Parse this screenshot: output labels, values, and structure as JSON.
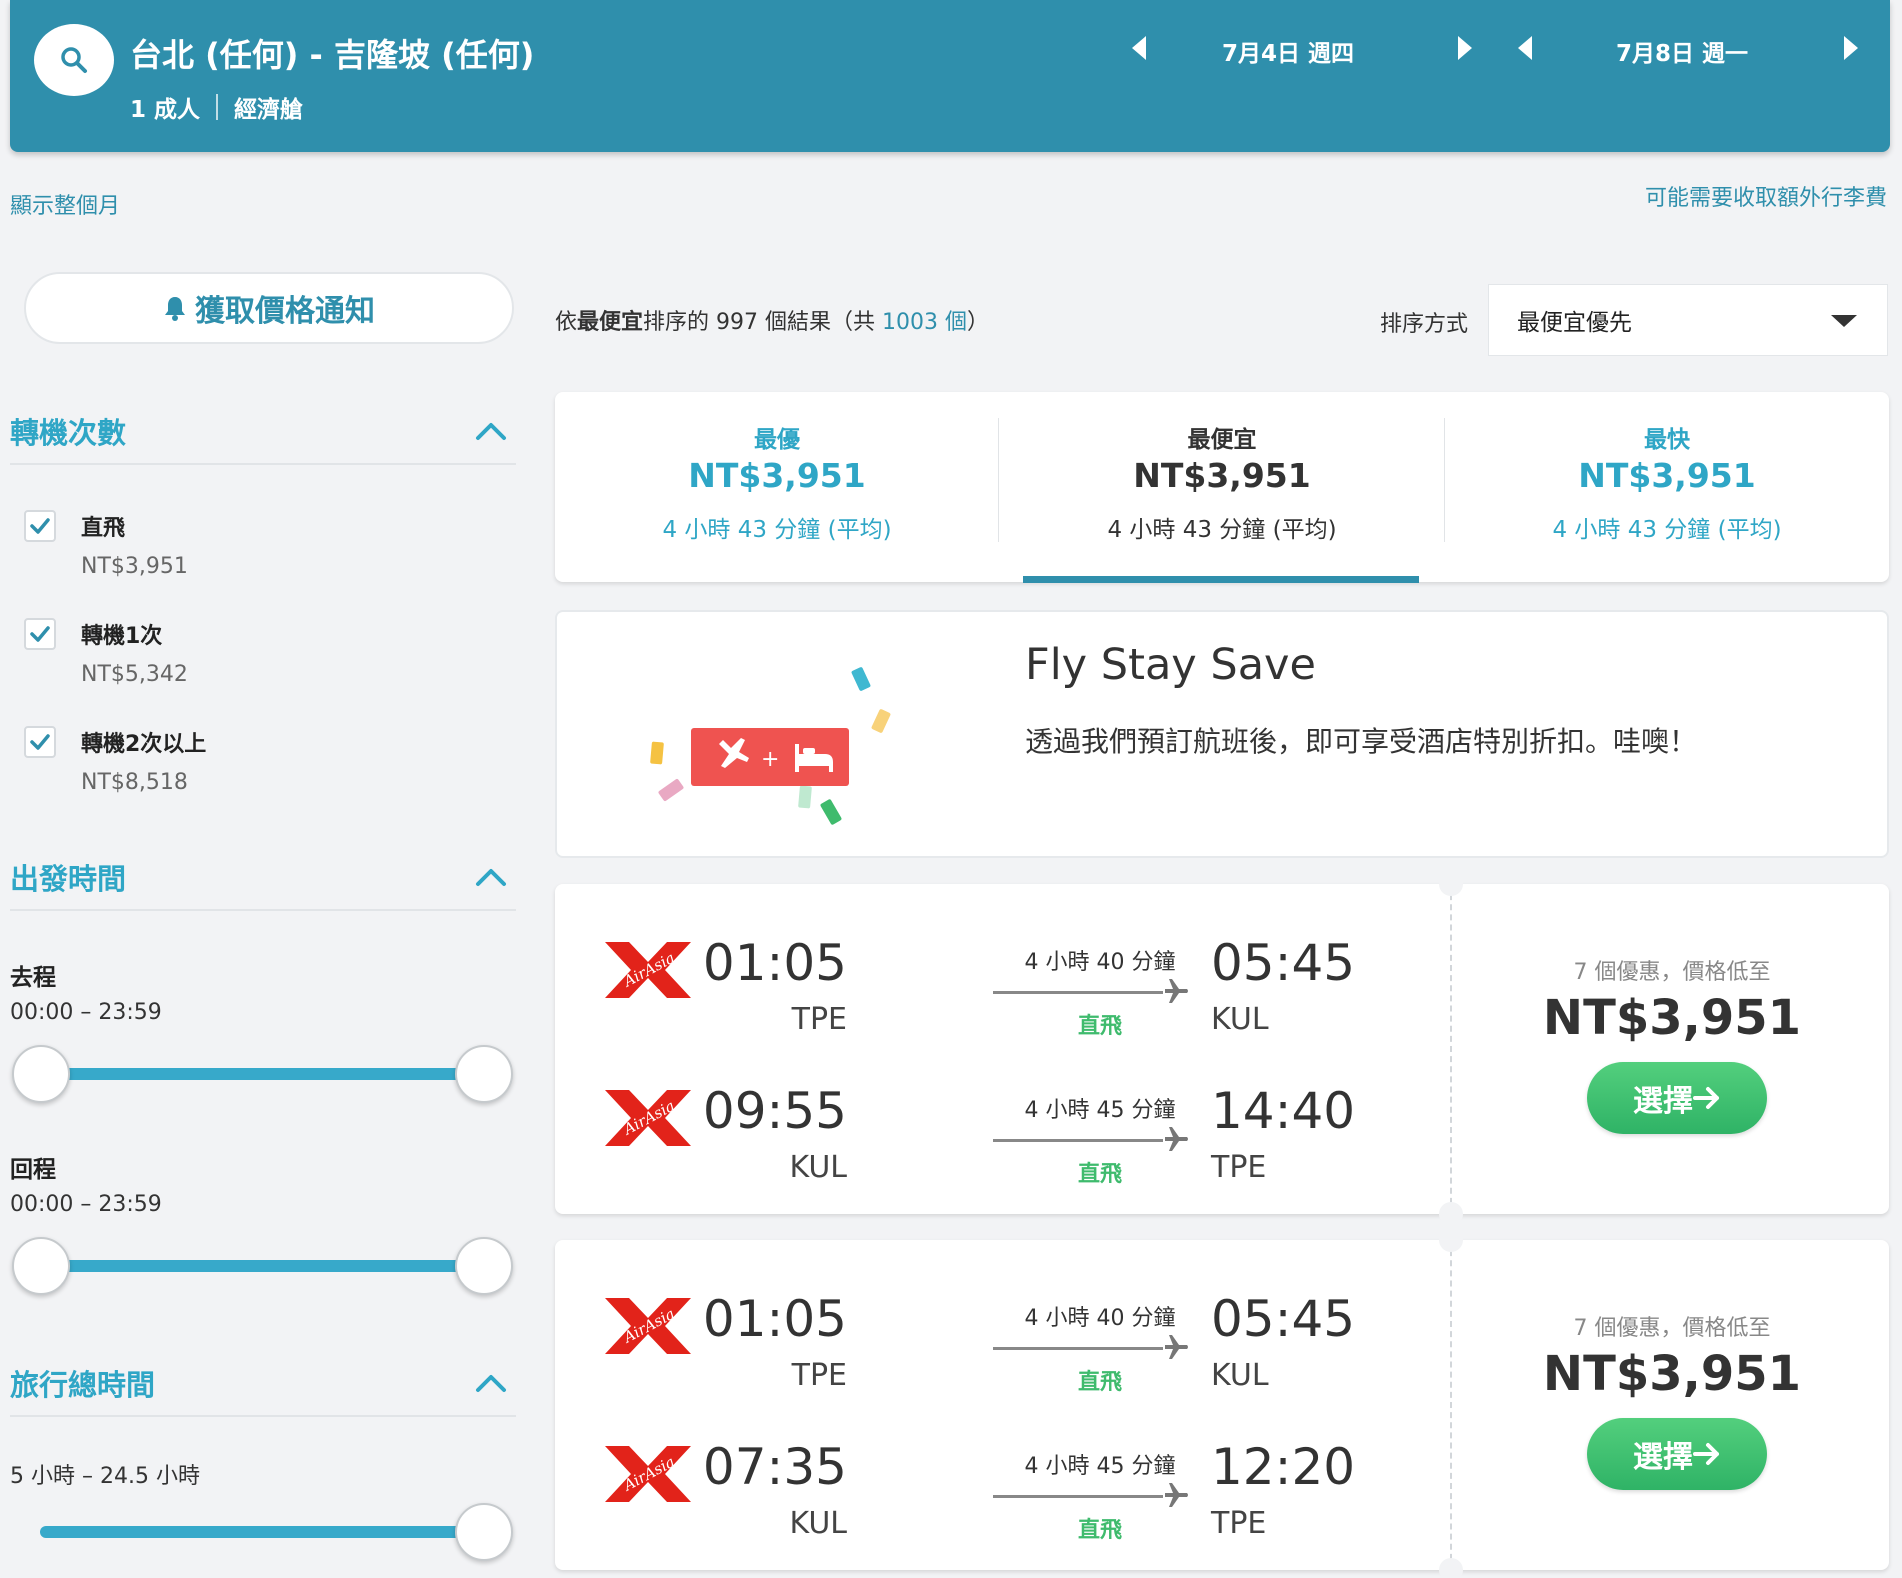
{
  "header": {
    "route": "台北 (任何) - 吉隆坡 (任何)",
    "passengers": "1 成人",
    "cabin": "經濟艙",
    "depart_date": "7月4日 週四",
    "return_date": "7月8日 週一"
  },
  "top_links": {
    "show_month": "顯示整個月",
    "baggage_notice": "可能需要收取額外行李費"
  },
  "sidebar": {
    "price_alert": "獲取價格通知",
    "stops": {
      "title": "轉機次數",
      "items": [
        {
          "label": "直飛",
          "price": "NT$3,951"
        },
        {
          "label": "轉機1次",
          "price": "NT$5,342"
        },
        {
          "label": "轉機2次以上",
          "price": "NT$8,518"
        }
      ]
    },
    "departure_time": {
      "title": "出發時間",
      "outbound_label": "去程",
      "outbound_range": "00:00 – 23:59",
      "return_label": "回程",
      "return_range": "00:00 – 23:59"
    },
    "total_duration": {
      "title": "旅行總時間",
      "range": "5 小時 – 24.5 小時"
    }
  },
  "results": {
    "summary_prefix": "依",
    "summary_sort": "最便宜",
    "summary_middle": "排序的 997 個結果（共 ",
    "summary_total": "1003 個",
    "summary_suffix": "）",
    "sort_label": "排序方式",
    "sort_value": "最便宜優先"
  },
  "sort_tabs": [
    {
      "title": "最優",
      "price": "NT$3,951",
      "duration": "4 小時 43 分鐘 (平均)"
    },
    {
      "title": "最便宜",
      "price": "NT$3,951",
      "duration": "4 小時 43 分鐘 (平均)"
    },
    {
      "title": "最快",
      "price": "NT$3,951",
      "duration": "4 小時 43 分鐘 (平均)"
    }
  ],
  "promo": {
    "title": "Fly Stay Save",
    "text": "透過我們預訂航班後，即可享受酒店特別折扣。哇噢！"
  },
  "flights": [
    {
      "legs": [
        {
          "dep_time": "01:05",
          "dep_code": "TPE",
          "duration": "4 小時 40 分鐘",
          "stops": "直飛",
          "arr_time": "05:45",
          "arr_code": "KUL"
        },
        {
          "dep_time": "09:55",
          "dep_code": "KUL",
          "duration": "4 小時 45 分鐘",
          "stops": "直飛",
          "arr_time": "14:40",
          "arr_code": "TPE"
        }
      ],
      "deals": "7 個優惠，價格低至",
      "price": "NT$3,951",
      "select": "選擇"
    },
    {
      "legs": [
        {
          "dep_time": "01:05",
          "dep_code": "TPE",
          "duration": "4 小時 40 分鐘",
          "stops": "直飛",
          "arr_time": "05:45",
          "arr_code": "KUL"
        },
        {
          "dep_time": "07:35",
          "dep_code": "KUL",
          "duration": "4 小時 45 分鐘",
          "stops": "直飛",
          "arr_time": "12:20",
          "arr_code": "TPE"
        }
      ],
      "deals": "7 個優惠，價格低至",
      "price": "NT$3,951",
      "select": "選擇"
    }
  ],
  "colors": {
    "header_bg": "#2f8fac",
    "accent_blue": "#2fa6c6",
    "direct_green": "#3fbb6d",
    "select_green": "#2fb366",
    "airasia_red": "#e2231a"
  }
}
